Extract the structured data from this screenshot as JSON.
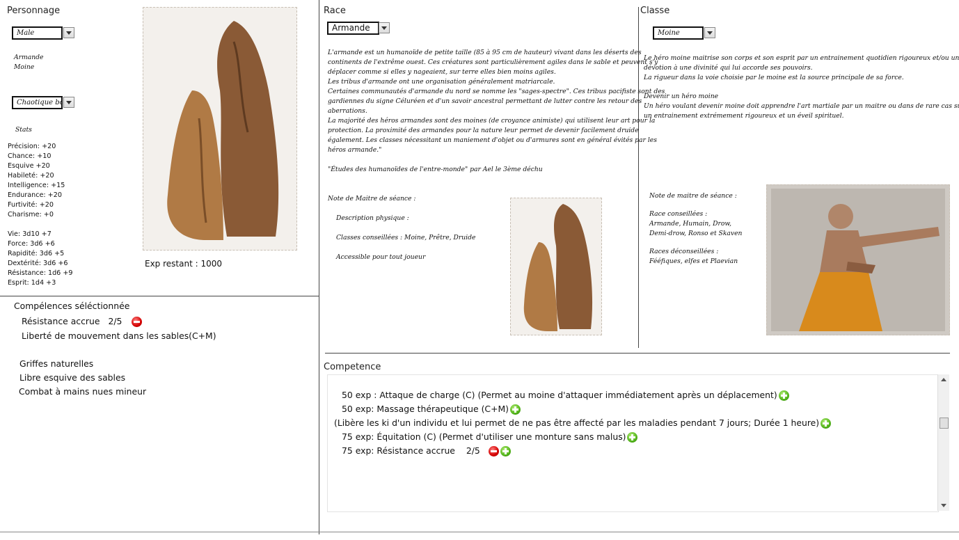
{
  "personnage": {
    "title": "Personnage",
    "sex": "Male",
    "race_name": "Armande",
    "class_name": "Moine",
    "alignment": "Chaotique bon",
    "stats_heading": "Stats",
    "stats": [
      "Précision: +20",
      "Chance: +10",
      "Esquive +20",
      "Habileté: +20",
      "Intelligence: +15",
      "Endurance: +20",
      "Furtivité: +20",
      "Charisme: +0"
    ],
    "vitals": [
      "Vie: 3d10 +7",
      "Force: 3d6 +6",
      "Rapidité: 3d6 +5",
      "Dextérité: 3d6 +6",
      "Résistance: 1d6 +9",
      "Esprit: 1d4 +3"
    ],
    "exp_label": "Exp restant : 1000",
    "image_icon": "armande-creature-illustration"
  },
  "competences_selected": {
    "title": "Compélences séléctionnée",
    "item1_label": "Résistance accrue",
    "item1_level": "2/5",
    "item2_label": "Liberté de mouvement dans les sables(C+M)",
    "item3_label": "Griffes naturelles",
    "item4_label": "Libre esquive des sables",
    "item5_label": "Combat à mains nues mineur"
  },
  "race": {
    "title": "Race",
    "selected": "Armande",
    "description": [
      "L'armande est un humanoïde de petite taille (85 à 95 cm de hauteur) vivant dans les déserts des",
      "continents de l'extrême ouest. Ces créatures sont particulièrement agiles dans le sable et peuvent s'y",
      "déplacer comme si elles y nageaient, sur terre elles bien moins agiles.",
      "Les tribus d'armande ont une organisation généralement matriarcale.",
      "Certaines communautés d'armande du nord se nomme les \"sages-spectre\". Ces tribus pacifiste sont des",
      "gardiennes du signe Céluréen et d'un savoir ancestral permettant de lutter contre les retour des",
      "aberrations.",
      "La majorité des héros armandes sont des moines (de croyance animiste) qui utilisent leur art pour la",
      "protection. La proximité des armandes pour la nature leur permet de devenir facilement druide",
      "également. Les classes nécessitant un maniement d'objet ou d'armures sont en général évités par les",
      "héros armande.\""
    ],
    "quote_source": "\"Études des humanoïdes de l'entre-monde\" par Ael le 3ème déchu",
    "gm_note_title": "Note de Maitre de séance :",
    "gm_desc": "Description physique :",
    "gm_classes": "Classes conseillées : Moine, Prêtre, Druide",
    "gm_access": "Accessible pour tout joueur"
  },
  "classe": {
    "title": "Classe",
    "selected": "Moine",
    "description": [
      "Le héro moine maitrise son corps et son esprit par un entrainement quotidien rigoureux et/ou une",
      "dévotion à une divinité qui lui accorde ses pouvoirs.",
      "La rigueur dans la voie choisie par le moine est la source principale de sa force."
    ],
    "become_title": "Devenir un héro moine",
    "become_text": [
      "Un héro voulant devenir moine doit apprendre l'art martiale par un maitre ou dans de rare cas subir",
      "un entrainement extrémement rigoureux et un éveil spirituel."
    ],
    "gm_note_title": "Note de maitre de séance :",
    "races_ok_title": "Race conseillées :",
    "races_ok": [
      "Armande, Humain, Drow,",
      "Demi-drow, Ronso et Skaven"
    ],
    "races_bad_title": "Races déconseillées :",
    "races_bad": [
      "Fééfiques, elfes et Plaevian"
    ],
    "image_icon": "monk-fighter-photo"
  },
  "competence": {
    "title": "Competence",
    "rows": [
      {
        "text": "50 exp : Attaque de charge (C) (Permet au moine d'attaquer immédiatement après un déplacement)"
      },
      {
        "text": "50 exp: Massage thérapeutique (C+M)"
      },
      {
        "text": "(Libère les ki d'un individu et lui permet de ne pas être affecté par les maladies pendant 7 jours; Durée 1 heure)"
      },
      {
        "text": "75 exp: Équitation (C) (Permet d'utiliser une monture sans malus)"
      },
      {
        "text": "75 exp: Résistance accrue",
        "level": "2/5"
      }
    ]
  },
  "colors": {
    "minus": "#d40000",
    "plus": "#52b41a",
    "lines": "#444444"
  }
}
